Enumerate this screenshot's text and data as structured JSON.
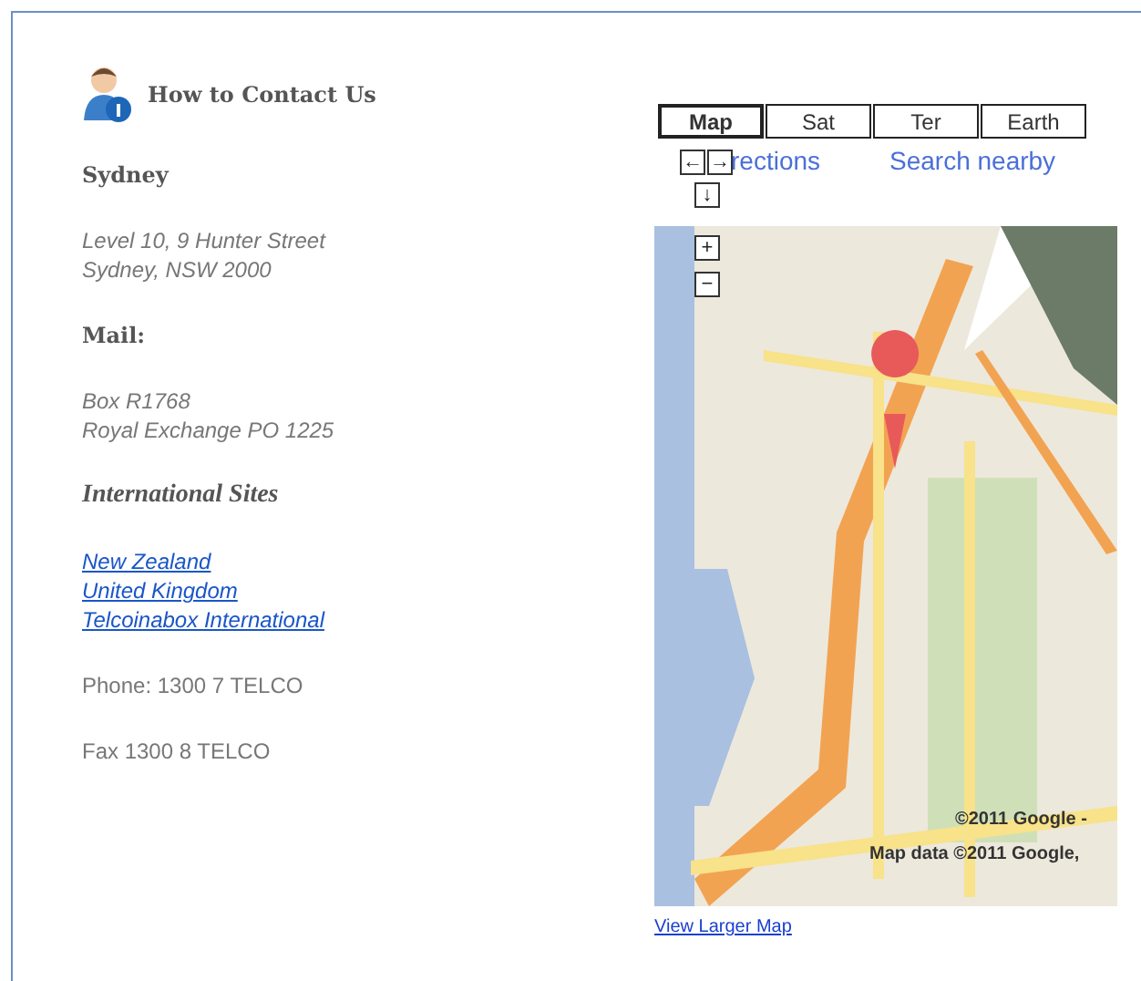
{
  "header": {
    "title": "How to Contact Us"
  },
  "blocks": [
    {
      "kind": "heading",
      "lines": [
        "Sydney"
      ]
    },
    {
      "kind": "address",
      "lines": [
        "Level 10, 9 Hunter Street",
        "Sydney, NSW 2000"
      ]
    },
    {
      "kind": "heading",
      "lines": [
        "Mail:"
      ]
    },
    {
      "kind": "address",
      "lines": [
        "Box R1768",
        "Royal Exchange PO 1225"
      ]
    },
    {
      "kind": "subheading",
      "lines": [
        "International Sites"
      ]
    },
    {
      "kind": "links",
      "lines": [
        "New Zealand",
        "United Kingdom",
        "Telcoinabox International"
      ]
    },
    {
      "kind": "plain",
      "lines": [
        "Phone: 1300 7 TELCO"
      ]
    },
    {
      "kind": "plain",
      "lines": [
        "Fax 1300 8 TELCO"
      ]
    }
  ],
  "map": {
    "tabs": [
      {
        "label": "Map",
        "selected": true
      },
      {
        "label": "Sat",
        "selected": false
      },
      {
        "label": "Ter",
        "selected": false
      },
      {
        "label": "Earth",
        "selected": false
      }
    ],
    "pan": {
      "left": "←",
      "right": "→",
      "down": "↓"
    },
    "zoom": {
      "in": "+",
      "out": "−"
    },
    "info_links": [
      "rections",
      "Search nearby"
    ],
    "copyright": [
      "©2011 Google -",
      "Map data ©2011 Google,"
    ],
    "view_larger": "View Larger Map"
  }
}
